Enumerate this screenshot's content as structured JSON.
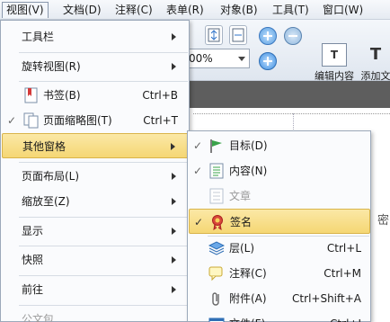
{
  "menubar": {
    "items": [
      {
        "label": "视图(V)"
      },
      {
        "label": "文档(D)"
      },
      {
        "label": "注释(C)"
      },
      {
        "label": "表单(R)"
      },
      {
        "label": "对象(B)"
      },
      {
        "label": "工具(T)"
      },
      {
        "label": "窗口(W)"
      }
    ]
  },
  "toolbar": {
    "zoom_value": "00%",
    "edit_content_label": "编辑内容",
    "add_text_label": "添加文"
  },
  "page": {
    "partial_text": "密"
  },
  "view_menu": {
    "items": [
      {
        "label": "工具栏",
        "shortcut": ""
      },
      {
        "label": "旋转视图(R)",
        "shortcut": ""
      },
      {
        "label": "书签(B)",
        "shortcut": "Ctrl+B"
      },
      {
        "label": "页面缩略图(T)",
        "shortcut": "Ctrl+T"
      },
      {
        "label": "其他窗格",
        "shortcut": ""
      },
      {
        "label": "页面布局(L)",
        "shortcut": ""
      },
      {
        "label": "缩放至(Z)",
        "shortcut": ""
      },
      {
        "label": "显示",
        "shortcut": ""
      },
      {
        "label": "快照",
        "shortcut": ""
      },
      {
        "label": "前往",
        "shortcut": ""
      },
      {
        "label": "公文包",
        "shortcut": ""
      }
    ]
  },
  "other_panes_submenu": {
    "items": [
      {
        "label": "目标(D)",
        "shortcut": ""
      },
      {
        "label": "内容(N)",
        "shortcut": ""
      },
      {
        "label": "文章",
        "shortcut": ""
      },
      {
        "label": "签名",
        "shortcut": ""
      },
      {
        "label": "层(L)",
        "shortcut": "Ctrl+L"
      },
      {
        "label": "注释(C)",
        "shortcut": "Ctrl+M"
      },
      {
        "label": "附件(A)",
        "shortcut": "Ctrl+Shift+A"
      },
      {
        "label": "文件(F)",
        "shortcut": "Ctrl+I"
      }
    ]
  },
  "colors": {
    "highlight": "#f5d774",
    "highlight_border": "#d9b44a",
    "menu_bg": "#fafbfd",
    "tabstrip": "#5e5e5e"
  }
}
